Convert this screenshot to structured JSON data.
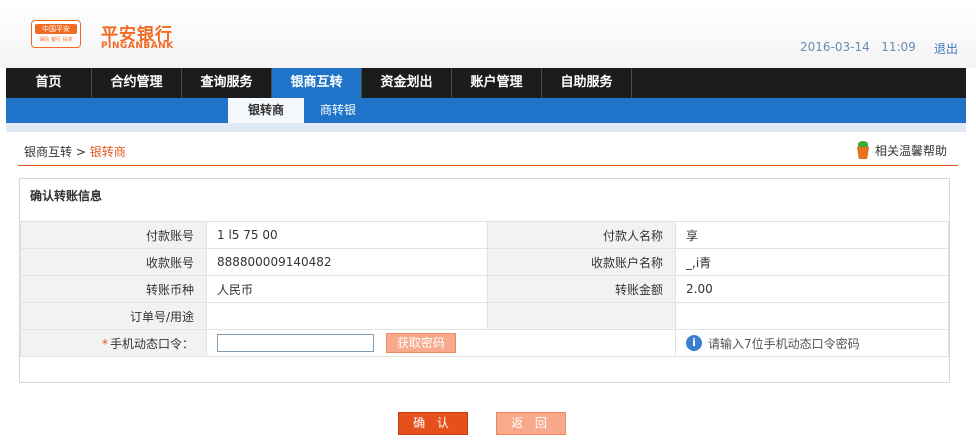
{
  "header": {
    "logo_cn": "中国平安",
    "logo_sub": "保险 银行 投资",
    "bank_name": "平安银行",
    "bank_en": "PINGANBANK",
    "date": "2016-03-14",
    "time": "11:09",
    "logout": "退出"
  },
  "mainnav": [
    {
      "label": "首页"
    },
    {
      "label": "合约管理"
    },
    {
      "label": "查询服务"
    },
    {
      "label": "银商互转"
    },
    {
      "label": "资金划出"
    },
    {
      "label": "账户管理"
    },
    {
      "label": "自助服务"
    }
  ],
  "subnav": [
    {
      "label": "银转商"
    },
    {
      "label": "商转银"
    }
  ],
  "breadcrumb": {
    "parent": "银商互转",
    "separator": ">",
    "current": "银转商"
  },
  "help_label": "相关温馨帮助",
  "panel": {
    "title": "确认转账信息",
    "rows": [
      {
        "l1": "付款账号",
        "v1": "1   l5   75   00",
        "l2": "付款人名称",
        "v2": "  享"
      },
      {
        "l1": "收款账号",
        "v1": "888800009140482",
        "l2": "收款账户名称",
        "v2": "_,i青"
      },
      {
        "l1": "转账币种",
        "v1": "人民币",
        "l2": "转账金额",
        "v2": "2.00"
      },
      {
        "l1": "订单号/用途",
        "v1": "",
        "l2": "",
        "v2": ""
      }
    ],
    "otp": {
      "required_mark": "*",
      "label": "手机动态口令：",
      "value": "",
      "button": "获取密码",
      "hint": "请输入7位手机动态口令密码"
    }
  },
  "buttons": {
    "confirm": "确 认",
    "back": "返 回"
  },
  "colors": {
    "brand_orange": "#f26a21",
    "nav_dark": "#1c1c1c",
    "nav_blue": "#1f74c9",
    "accent_red": "#e1581d"
  }
}
